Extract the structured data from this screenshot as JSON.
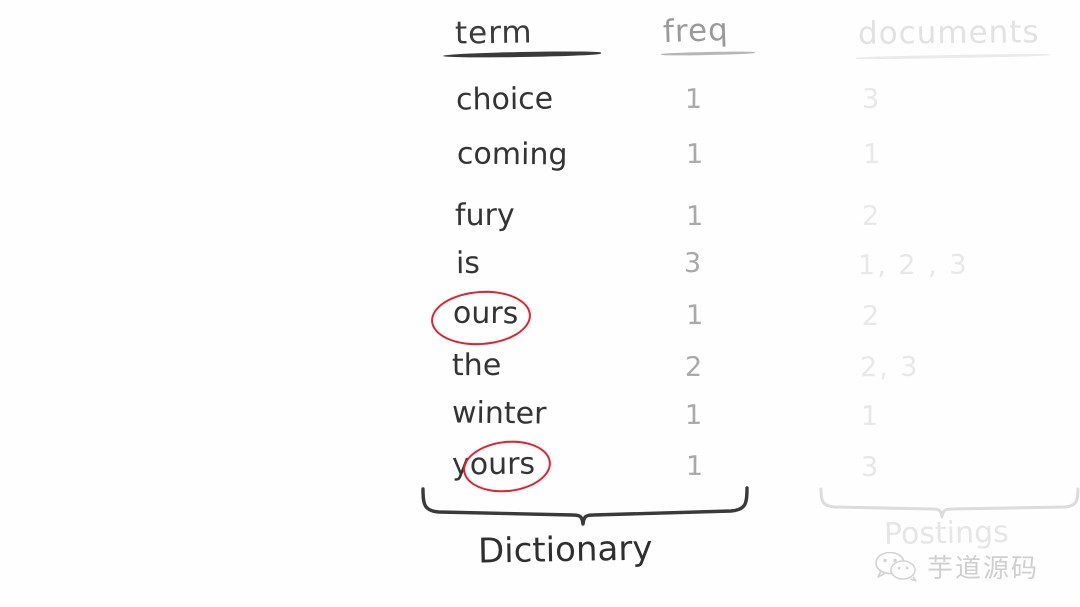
{
  "table": {
    "headers": {
      "term": "term",
      "freq": "freq",
      "documents": "documents"
    },
    "rows": [
      {
        "term": "choice",
        "freq": "1",
        "documents": "3",
        "highlighted": false
      },
      {
        "term": "coming",
        "freq": "1",
        "documents": "1",
        "highlighted": false
      },
      {
        "term": "fury",
        "freq": "1",
        "documents": "2",
        "highlighted": false
      },
      {
        "term": "is",
        "freq": "3",
        "documents": "1, 2 , 3",
        "highlighted": false
      },
      {
        "term": "ours",
        "freq": "1",
        "documents": "2",
        "highlighted": true
      },
      {
        "term": "the",
        "freq": "2",
        "documents": "2, 3",
        "highlighted": false
      },
      {
        "term": "winter",
        "freq": "1",
        "documents": "1",
        "highlighted": false
      },
      {
        "term": "yours",
        "freq": "1",
        "documents": "3",
        "highlighted": true
      }
    ]
  },
  "annotations": {
    "dictionary_label": "Dictionary",
    "postings_label": "Postings",
    "circle_color": "#e02330"
  },
  "watermark": {
    "text": "芋道源码",
    "icon": "wechat-icon"
  },
  "colors": {
    "term_ink": "#343434",
    "freq_ink": "#a9a9a9",
    "documents_ink": "#e8e8e8",
    "background": "#fefefe"
  }
}
